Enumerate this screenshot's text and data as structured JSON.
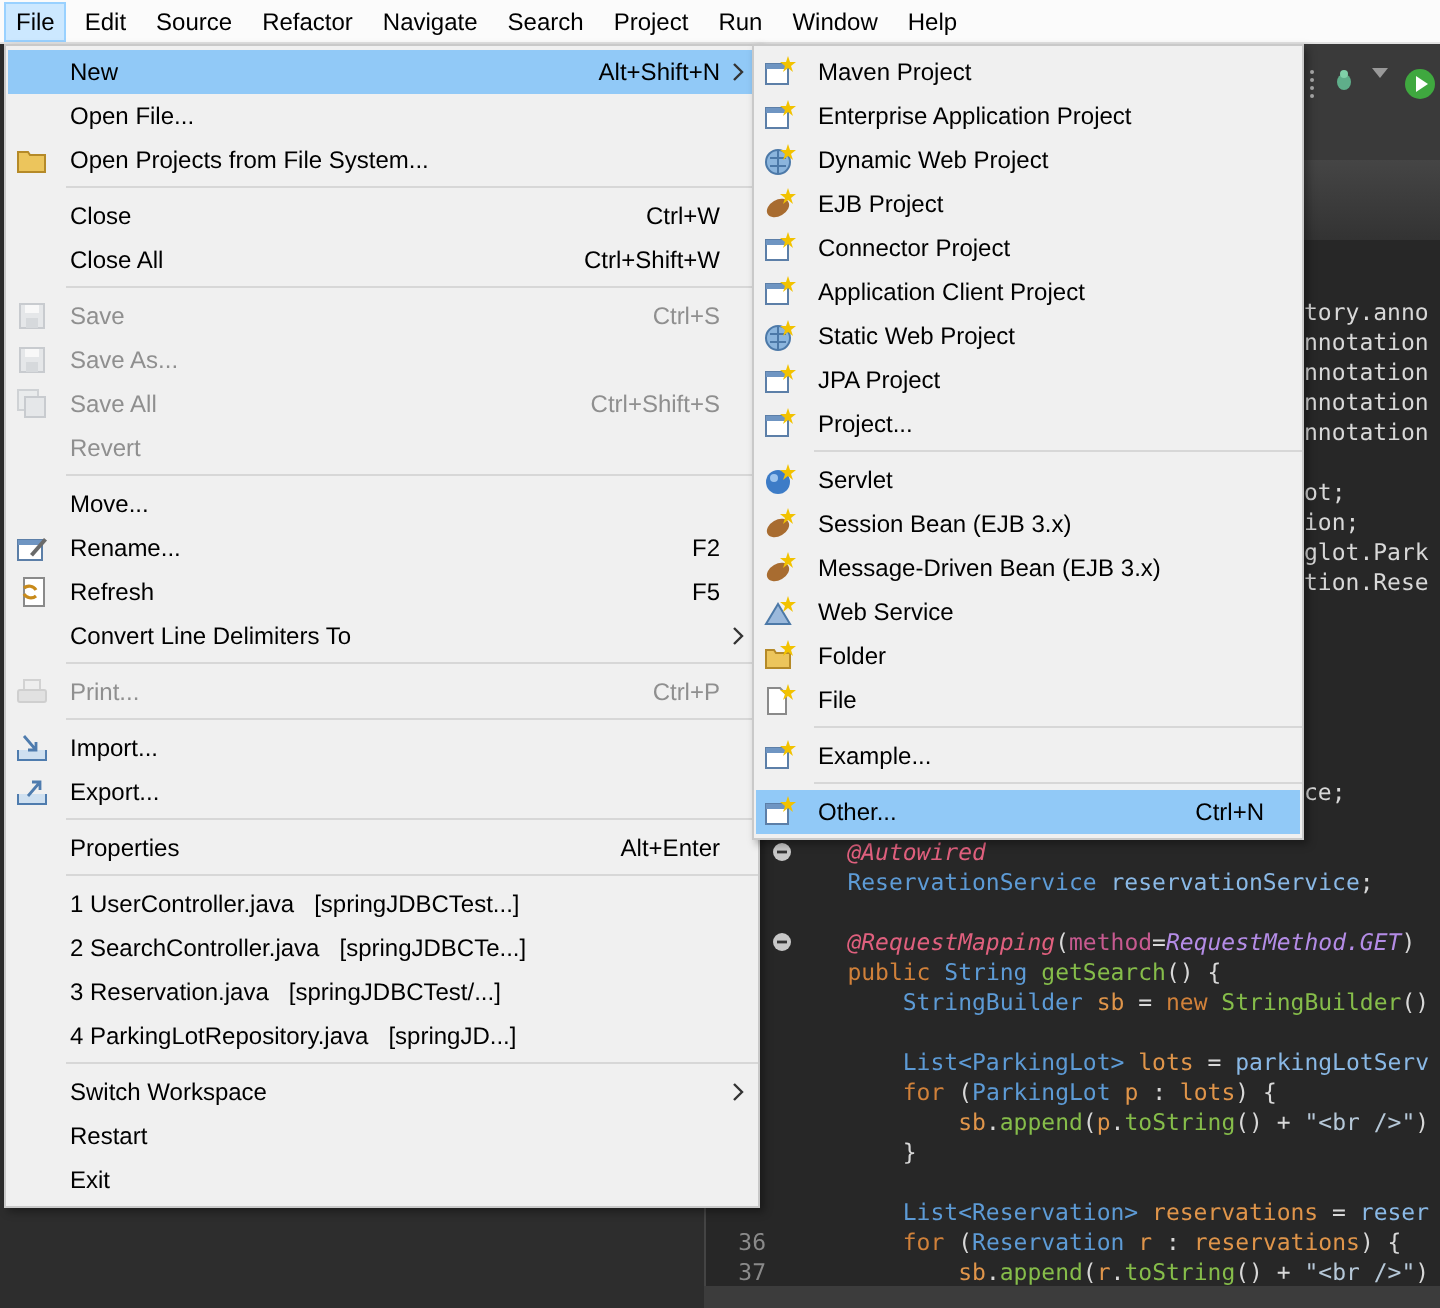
{
  "menubar": [
    {
      "label": "File",
      "selected": true
    },
    {
      "label": "Edit",
      "selected": false
    },
    {
      "label": "Source",
      "selected": false
    },
    {
      "label": "Refactor",
      "selected": false
    },
    {
      "label": "Navigate",
      "selected": false
    },
    {
      "label": "Search",
      "selected": false
    },
    {
      "label": "Project",
      "selected": false
    },
    {
      "label": "Run",
      "selected": false
    },
    {
      "label": "Window",
      "selected": false
    },
    {
      "label": "Help",
      "selected": false
    }
  ],
  "file_menu": {
    "items": [
      {
        "kind": "item",
        "label": "New",
        "shortcut": "Alt+Shift+N",
        "submenu": true,
        "selected": true,
        "disabled": false
      },
      {
        "kind": "item",
        "label": "Open File...",
        "selected": false,
        "disabled": false
      },
      {
        "kind": "item",
        "label": "Open Projects from File System...",
        "selected": false,
        "disabled": false
      },
      {
        "kind": "separator"
      },
      {
        "kind": "item",
        "label": "Close",
        "shortcut": "Ctrl+W",
        "selected": false,
        "disabled": false
      },
      {
        "kind": "item",
        "label": "Close All",
        "shortcut": "Ctrl+Shift+W",
        "selected": false,
        "disabled": false
      },
      {
        "kind": "separator"
      },
      {
        "kind": "item",
        "label": "Save",
        "shortcut": "Ctrl+S",
        "selected": false,
        "disabled": true
      },
      {
        "kind": "item",
        "label": "Save As...",
        "selected": false,
        "disabled": true
      },
      {
        "kind": "item",
        "label": "Save All",
        "shortcut": "Ctrl+Shift+S",
        "selected": false,
        "disabled": true
      },
      {
        "kind": "item",
        "label": "Revert",
        "selected": false,
        "disabled": true
      },
      {
        "kind": "separator"
      },
      {
        "kind": "item",
        "label": "Move...",
        "selected": false,
        "disabled": false
      },
      {
        "kind": "item",
        "label": "Rename...",
        "shortcut": "F2",
        "selected": false,
        "disabled": false
      },
      {
        "kind": "item",
        "label": "Refresh",
        "shortcut": "F5",
        "selected": false,
        "disabled": false
      },
      {
        "kind": "item",
        "label": "Convert Line Delimiters To",
        "submenu": true,
        "selected": false,
        "disabled": false
      },
      {
        "kind": "separator"
      },
      {
        "kind": "item",
        "label": "Print...",
        "shortcut": "Ctrl+P",
        "selected": false,
        "disabled": true
      },
      {
        "kind": "separator"
      },
      {
        "kind": "item",
        "label": "Import...",
        "selected": false,
        "disabled": false
      },
      {
        "kind": "item",
        "label": "Export...",
        "selected": false,
        "disabled": false
      },
      {
        "kind": "separator"
      },
      {
        "kind": "item",
        "label": "Properties",
        "shortcut": "Alt+Enter",
        "selected": false,
        "disabled": false
      },
      {
        "kind": "separator"
      },
      {
        "kind": "recent",
        "label": "1 UserController.java",
        "project": "[springJDBCTest...]",
        "selected": false,
        "disabled": false
      },
      {
        "kind": "recent",
        "label": "2 SearchController.java",
        "project": "[springJDBCTe...]",
        "selected": false,
        "disabled": false
      },
      {
        "kind": "recent",
        "label": "3 Reservation.java",
        "project": "[springJDBCTest/...]",
        "selected": false,
        "disabled": false
      },
      {
        "kind": "recent",
        "label": "4 ParkingLotRepository.java",
        "project": "[springJD...]",
        "selected": false,
        "disabled": false
      },
      {
        "kind": "separator"
      },
      {
        "kind": "item",
        "label": "Switch Workspace",
        "submenu": true,
        "selected": false,
        "disabled": false
      },
      {
        "kind": "item",
        "label": "Restart",
        "selected": false,
        "disabled": false
      },
      {
        "kind": "item",
        "label": "Exit",
        "selected": false,
        "disabled": false
      }
    ]
  },
  "new_submenu": {
    "items": [
      {
        "kind": "item",
        "label": "Maven Project",
        "selected": false,
        "disabled": false
      },
      {
        "kind": "item",
        "label": "Enterprise Application Project",
        "selected": false,
        "disabled": false
      },
      {
        "kind": "item",
        "label": "Dynamic Web Project",
        "selected": false,
        "disabled": false
      },
      {
        "kind": "item",
        "label": "EJB Project",
        "selected": false,
        "disabled": false
      },
      {
        "kind": "item",
        "label": "Connector Project",
        "selected": false,
        "disabled": false
      },
      {
        "kind": "item",
        "label": "Application Client Project",
        "selected": false,
        "disabled": false
      },
      {
        "kind": "item",
        "label": "Static Web Project",
        "selected": false,
        "disabled": false
      },
      {
        "kind": "item",
        "label": "JPA Project",
        "selected": false,
        "disabled": false
      },
      {
        "kind": "item",
        "label": "Project...",
        "selected": false,
        "disabled": false
      },
      {
        "kind": "separator"
      },
      {
        "kind": "item",
        "label": "Servlet",
        "selected": false,
        "disabled": false
      },
      {
        "kind": "item",
        "label": "Session Bean (EJB 3.x)",
        "selected": false,
        "disabled": false
      },
      {
        "kind": "item",
        "label": "Message-Driven Bean (EJB 3.x)",
        "selected": false,
        "disabled": false
      },
      {
        "kind": "item",
        "label": "Web Service",
        "selected": false,
        "disabled": false
      },
      {
        "kind": "item",
        "label": "Folder",
        "selected": false,
        "disabled": false
      },
      {
        "kind": "item",
        "label": "File",
        "selected": false,
        "disabled": false
      },
      {
        "kind": "separator"
      },
      {
        "kind": "item",
        "label": "Example...",
        "selected": false,
        "disabled": false
      },
      {
        "kind": "separator"
      },
      {
        "kind": "item",
        "label": "Other...",
        "shortcut": "Ctrl+N",
        "selected": true,
        "disabled": false
      }
    ]
  },
  "editor": {
    "lines": [
      {
        "kind": "clipped",
        "text": "tory.anno"
      },
      {
        "kind": "clipped",
        "text": "nnotation"
      },
      {
        "kind": "clipped",
        "text": "nnotation"
      },
      {
        "kind": "clipped",
        "text": "nnotation"
      },
      {
        "kind": "clipped",
        "text": "nnotation"
      },
      {
        "kind": "blank"
      },
      {
        "kind": "clipped",
        "text": "ot;"
      },
      {
        "kind": "clipped",
        "text": "ion;"
      },
      {
        "kind": "clipped",
        "text": "glot.Park"
      },
      {
        "kind": "clipped",
        "text": "tion.Rese"
      },
      {
        "kind": "blank"
      },
      {
        "kind": "blank"
      },
      {
        "kind": "blank"
      },
      {
        "kind": "blank"
      },
      {
        "kind": "blank"
      },
      {
        "kind": "blank"
      },
      {
        "kind": "clipped",
        "text": "ce;"
      },
      {
        "kind": "blank"
      },
      {
        "kind": "code",
        "fold": true,
        "tokens": [
          {
            "kind": "annotation",
            "text": "    @Autowired"
          }
        ]
      },
      {
        "kind": "code",
        "tokens": [
          {
            "kind": "type",
            "text": "    ReservationService"
          },
          {
            "kind": "field",
            "text": " reservationService"
          },
          {
            "kind": "plain",
            "text": ";"
          }
        ]
      },
      {
        "kind": "blank"
      },
      {
        "kind": "code",
        "fold": true,
        "tokens": [
          {
            "kind": "annotation",
            "text": "    @RequestMapping"
          },
          {
            "kind": "plain",
            "text": "("
          },
          {
            "kind": "attribute",
            "text": "method"
          },
          {
            "kind": "plain",
            "text": "="
          },
          {
            "kind": "constant",
            "text": "RequestMethod.GET"
          },
          {
            "kind": "plain",
            "text": ")"
          }
        ]
      },
      {
        "kind": "code",
        "tokens": [
          {
            "kind": "keyword",
            "text": "    public"
          },
          {
            "kind": "type",
            "text": " String"
          },
          {
            "kind": "method",
            "text": " getSearch"
          },
          {
            "kind": "plain",
            "text": "() {"
          }
        ]
      },
      {
        "kind": "code",
        "tokens": [
          {
            "kind": "type",
            "text": "        StringBuilder"
          },
          {
            "kind": "local",
            "text": " sb"
          },
          {
            "kind": "plain",
            "text": " = "
          },
          {
            "kind": "keyword",
            "text": "new"
          },
          {
            "kind": "method",
            "text": " StringBuilder"
          },
          {
            "kind": "plain",
            "text": "()"
          }
        ]
      },
      {
        "kind": "blank"
      },
      {
        "kind": "code",
        "tokens": [
          {
            "kind": "type",
            "text": "        List<ParkingLot>"
          },
          {
            "kind": "local",
            "text": " lots"
          },
          {
            "kind": "plain",
            "text": " = "
          },
          {
            "kind": "field",
            "text": "parkingLotServ"
          }
        ]
      },
      {
        "kind": "code",
        "tokens": [
          {
            "kind": "keyword",
            "text": "        for"
          },
          {
            "kind": "plain",
            "text": " ("
          },
          {
            "kind": "type",
            "text": "ParkingLot"
          },
          {
            "kind": "local",
            "text": " p"
          },
          {
            "kind": "plain",
            "text": " : "
          },
          {
            "kind": "local",
            "text": "lots"
          },
          {
            "kind": "plain",
            "text": ") {"
          }
        ]
      },
      {
        "kind": "code",
        "tokens": [
          {
            "kind": "local",
            "text": "            sb"
          },
          {
            "kind": "plain",
            "text": "."
          },
          {
            "kind": "method",
            "text": "append"
          },
          {
            "kind": "plain",
            "text": "("
          },
          {
            "kind": "local",
            "text": "p"
          },
          {
            "kind": "plain",
            "text": "."
          },
          {
            "kind": "method",
            "text": "toString"
          },
          {
            "kind": "plain",
            "text": "() + "
          },
          {
            "kind": "string",
            "text": "\"<br />\""
          },
          {
            "kind": "plain",
            "text": ")"
          }
        ]
      },
      {
        "kind": "code",
        "tokens": [
          {
            "kind": "plain",
            "text": "        }"
          }
        ]
      },
      {
        "kind": "blank"
      },
      {
        "kind": "code",
        "tokens": [
          {
            "kind": "type",
            "text": "        List<Reservation>"
          },
          {
            "kind": "local",
            "text": " reservations"
          },
          {
            "kind": "plain",
            "text": " = "
          },
          {
            "kind": "field",
            "text": "reser"
          }
        ]
      },
      {
        "kind": "code",
        "line_number": "36",
        "tokens": [
          {
            "kind": "keyword",
            "text": "        for"
          },
          {
            "kind": "plain",
            "text": " ("
          },
          {
            "kind": "type",
            "text": "Reservation"
          },
          {
            "kind": "local",
            "text": " r"
          },
          {
            "kind": "plain",
            "text": " : "
          },
          {
            "kind": "local",
            "text": "reservations"
          },
          {
            "kind": "plain",
            "text": ") {"
          }
        ]
      },
      {
        "kind": "code",
        "line_number": "37",
        "tokens": [
          {
            "kind": "local",
            "text": "            sb"
          },
          {
            "kind": "plain",
            "text": "."
          },
          {
            "kind": "method",
            "text": "append"
          },
          {
            "kind": "plain",
            "text": "("
          },
          {
            "kind": "local",
            "text": "r"
          },
          {
            "kind": "plain",
            "text": "."
          },
          {
            "kind": "method",
            "text": "toString"
          },
          {
            "kind": "plain",
            "text": "() + "
          },
          {
            "kind": "string",
            "text": "\"<br />\""
          },
          {
            "kind": "plain",
            "text": ")"
          }
        ]
      }
    ]
  }
}
